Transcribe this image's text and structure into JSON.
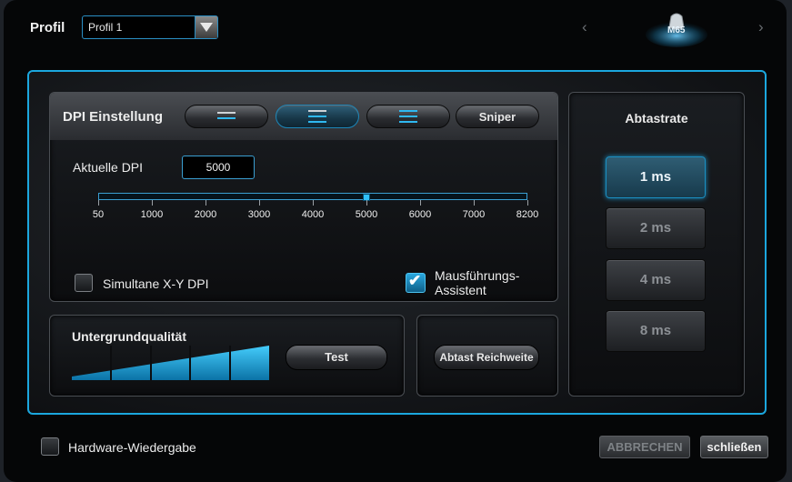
{
  "header": {
    "profile_label": "Profil",
    "profile_selected": "Profil 1",
    "device_name": "M65"
  },
  "dpi": {
    "title": "DPI Einstellung",
    "modes": [
      {
        "name": "dpi-mode-1",
        "bars": 2,
        "active_bars": 1
      },
      {
        "name": "dpi-mode-2",
        "bars": 3,
        "active_bars": 2
      },
      {
        "name": "dpi-mode-3",
        "bars": 3,
        "active_bars": 3
      }
    ],
    "sniper_label": "Sniper",
    "current_label": "Aktuelle DPI",
    "current_value": "5000",
    "slider": {
      "min": 50,
      "max": 8200,
      "value": 5000,
      "ticks": [
        "50",
        "1000",
        "2000",
        "3000",
        "4000",
        "5000",
        "6000",
        "7000",
        "8200"
      ]
    },
    "xy_label": "Simultane X-Y DPI",
    "xy_checked": false,
    "assist_label_1": "Mausführungs-",
    "assist_label_2": "Assistent",
    "assist_checked": true
  },
  "quality": {
    "title": "Untergrundqualität",
    "level": 5,
    "max_level": 5,
    "test_label": "Test"
  },
  "range": {
    "button_label": "Abtast Reichweite"
  },
  "rate": {
    "title": "Abtastrate",
    "options": [
      "1 ms",
      "2 ms",
      "4 ms",
      "8 ms"
    ],
    "selected": "1 ms"
  },
  "footer": {
    "hardware_label": "Hardware-Wiedergabe",
    "hardware_checked": false,
    "cancel_label": "ABBRECHEN",
    "close_label": "schließen"
  },
  "colors": {
    "accent": "#1ba7de",
    "active_bar": "#2fb8f0",
    "background": "#050607"
  }
}
